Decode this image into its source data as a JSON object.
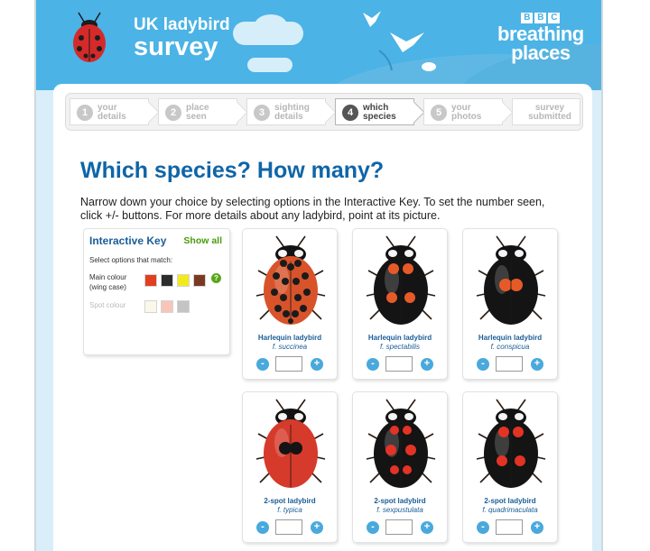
{
  "header": {
    "title_line1": "UK ladybird",
    "title_line2": "survey",
    "bbc_letters": [
      "B",
      "B",
      "C"
    ],
    "brand_line1": "breathing",
    "brand_line2": "places",
    "header_color": "#4bb3e6"
  },
  "steps": [
    {
      "num": "1",
      "line1": "your",
      "line2": "details",
      "active": false
    },
    {
      "num": "2",
      "line1": "place",
      "line2": "seen",
      "active": false
    },
    {
      "num": "3",
      "line1": "sighting",
      "line2": "details",
      "active": false
    },
    {
      "num": "4",
      "line1": "which",
      "line2": "species",
      "active": true
    },
    {
      "num": "5",
      "line1": "your",
      "line2": "photos",
      "active": false
    },
    {
      "num": "",
      "line1": "survey",
      "line2": "submitted",
      "active": false
    }
  ],
  "page": {
    "heading": "Which species? How many?",
    "intro": "Narrow down your choice by selecting options in the Interactive Key. To set the number seen, click +/- buttons. For more details about any ladybird, point at its picture."
  },
  "key": {
    "title": "Interactive Key",
    "show_all": "Show all",
    "subtitle": "Select options that match:",
    "main_colour_label": "Main colour (wing case)",
    "spot_colour_label": "Spot colour",
    "help": "?",
    "main_colours": [
      "#e0401f",
      "#2d2d2d",
      "#f3ea1e",
      "#7a3a22"
    ],
    "spot_colours": [
      "#fbf8ea",
      "#f7c6b8",
      "#c4c4c4"
    ]
  },
  "controls": {
    "minus": "-",
    "plus": "+"
  },
  "species": [
    {
      "name": "Harlequin ladybird",
      "form": "f. succinea",
      "count": "",
      "body": "#d8532a",
      "spot": "#1b1b1b",
      "spots": 16
    },
    {
      "name": "Harlequin ladybird",
      "form": "f. spectabilis",
      "count": "",
      "body": "#141414",
      "spot": "#e65a28",
      "spots": 4
    },
    {
      "name": "Harlequin ladybird",
      "form": "f. conspicua",
      "count": "",
      "body": "#141414",
      "spot": "#e65a28",
      "spots": 2
    },
    {
      "name": "2-spot ladybird",
      "form": "f. typica",
      "count": "",
      "body": "#d63a2b",
      "spot": "#141414",
      "spots": 2
    },
    {
      "name": "2-spot ladybird",
      "form": "f. sexpustulata",
      "count": "",
      "body": "#141414",
      "spot": "#e33326",
      "spots": 6
    },
    {
      "name": "2-spot ladybird",
      "form": "f. quadrimaculata",
      "count": "",
      "body": "#141414",
      "spot": "#e33326",
      "spots": 4
    }
  ]
}
